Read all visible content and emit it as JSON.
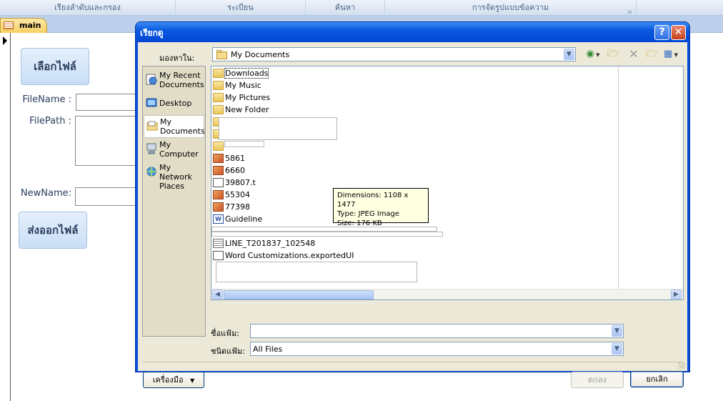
{
  "ribbon": {
    "groups": [
      "เรียงลำดับและกรอง",
      "ระเบียน",
      "ค้นหา",
      "การจัดรูปแบบข้อความ"
    ]
  },
  "document_tab": {
    "label": "main"
  },
  "form": {
    "select_file_button": "เลือกไฟล์",
    "filename_label": "FileName :",
    "filepath_label": "FilePath :",
    "newname_label": "NewName:",
    "export_file_button": "ส่งออกไฟล์"
  },
  "dialog": {
    "title": "เรียกดู",
    "help_button": "?",
    "close_button": "✕",
    "look_in_label": "มองหาใน:",
    "look_in_value": "My Documents",
    "places": [
      {
        "label": "My Recent Documents",
        "icon": "recent-documents-icon"
      },
      {
        "label": "Desktop",
        "icon": "desktop-icon"
      },
      {
        "label": "My Documents",
        "icon": "my-documents-icon",
        "selected": true
      },
      {
        "label": "My Computer",
        "icon": "my-computer-icon"
      },
      {
        "label": "My Network Places",
        "icon": "network-places-icon"
      }
    ],
    "files": [
      {
        "name": "Downloads",
        "type": "folder"
      },
      {
        "name": "My Music",
        "type": "folder"
      },
      {
        "name": "My Pictures",
        "type": "folder"
      },
      {
        "name": "New Folder",
        "type": "folder"
      },
      {
        "name": "5861",
        "type": "image"
      },
      {
        "name": "6660",
        "type": "image"
      },
      {
        "name": "39807.t",
        "type": "ui"
      },
      {
        "name": "55304",
        "type": "image"
      },
      {
        "name": "77398",
        "type": "image"
      },
      {
        "name": "Guideline",
        "type": "word"
      },
      {
        "name": "LINE_T201837_102548",
        "type": "text"
      },
      {
        "name": "Word Customizations.exportedUI",
        "type": "ui"
      }
    ],
    "tooltip": {
      "dimensions": "Dimensions: 1108 x 1477",
      "type": "Type: JPEG Image",
      "size": "Size: 176 KB"
    },
    "filename_label": "ชื่อแฟ้ม:",
    "filename_value": "",
    "filetype_label": "ชนิดแฟ้ม:",
    "filetype_value": "All Files",
    "tools_button": "เครื่องมือ",
    "ok_button": "ตกลง",
    "cancel_button": "ยกเลิก"
  }
}
